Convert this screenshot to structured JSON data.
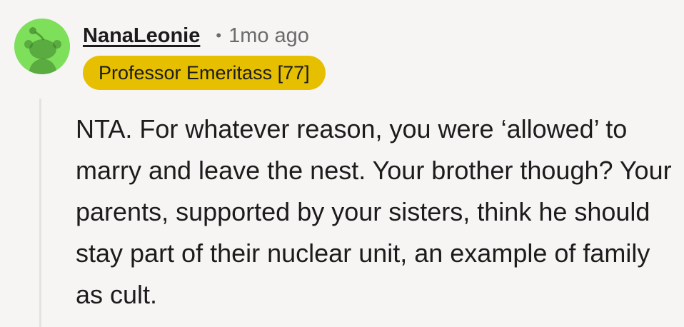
{
  "comment": {
    "username": "NanaLeonie",
    "separator": "•",
    "timestamp": "1mo ago",
    "flair": {
      "text": "Professor Emeritass [77]",
      "color": "#e6bf00"
    },
    "avatar": {
      "icon": "snoo-avatar-icon",
      "background": "#7ee05a"
    },
    "body": "NTA. For whatever reason, you were ‘allowed’ to marry and leave the nest. Your brother though? Your parents, supported by your sisters, think he should stay part of their nuclear unit, an example of family as cult."
  }
}
